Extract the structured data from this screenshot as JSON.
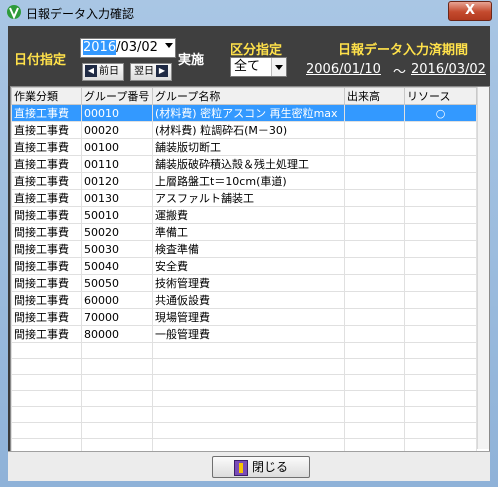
{
  "window": {
    "title": "日報データ入力確認",
    "close_symbol": "X"
  },
  "header": {
    "date_label": "日付指定",
    "date_value_selected": "2016",
    "date_value_rest": "/03/02",
    "prev_day_label": "前日",
    "next_day_label": "翌日",
    "jisshi_label": "実施",
    "category_label": "区分指定",
    "category_value": "全て",
    "period_label": "日報データ入力済期間",
    "period_start": "2006/01/10",
    "period_sep": "〜",
    "period_end": "2016/03/02"
  },
  "grid": {
    "columns": [
      "作業分類",
      "グループ番号",
      "グループ名称",
      "出来高",
      "リソース"
    ],
    "rows": [
      {
        "category": "直接工事費",
        "group_no": "00010",
        "group_name": "(材料費) 密粒アスコン 再生密粒max",
        "dekidaka": "",
        "resource": "○",
        "selected": true
      },
      {
        "category": "直接工事費",
        "group_no": "00020",
        "group_name": "(材料費) 粒調砕石(M－30)",
        "dekidaka": "",
        "resource": ""
      },
      {
        "category": "直接工事費",
        "group_no": "00100",
        "group_name": "舗装版切断工",
        "dekidaka": "",
        "resource": ""
      },
      {
        "category": "直接工事費",
        "group_no": "00110",
        "group_name": "舗装版破砕積込殻＆残土処理工",
        "dekidaka": "",
        "resource": ""
      },
      {
        "category": "直接工事費",
        "group_no": "00120",
        "group_name": "上層路盤工t＝10cm(車道)",
        "dekidaka": "",
        "resource": ""
      },
      {
        "category": "直接工事費",
        "group_no": "00130",
        "group_name": "アスファルト舗装工",
        "dekidaka": "",
        "resource": ""
      },
      {
        "category": "間接工事費",
        "group_no": "50010",
        "group_name": "運搬費",
        "dekidaka": "",
        "resource": ""
      },
      {
        "category": "間接工事費",
        "group_no": "50020",
        "group_name": "準備工",
        "dekidaka": "",
        "resource": ""
      },
      {
        "category": "間接工事費",
        "group_no": "50030",
        "group_name": "検査準備",
        "dekidaka": "",
        "resource": ""
      },
      {
        "category": "間接工事費",
        "group_no": "50040",
        "group_name": "安全費",
        "dekidaka": "",
        "resource": ""
      },
      {
        "category": "間接工事費",
        "group_no": "50050",
        "group_name": "技術管理費",
        "dekidaka": "",
        "resource": ""
      },
      {
        "category": "間接工事費",
        "group_no": "60000",
        "group_name": "共通仮設費",
        "dekidaka": "",
        "resource": ""
      },
      {
        "category": "間接工事費",
        "group_no": "70000",
        "group_name": "現場管理費",
        "dekidaka": "",
        "resource": ""
      },
      {
        "category": "間接工事費",
        "group_no": "80000",
        "group_name": "一般管理費",
        "dekidaka": "",
        "resource": ""
      }
    ]
  },
  "footer": {
    "close_label": "閉じる"
  }
}
